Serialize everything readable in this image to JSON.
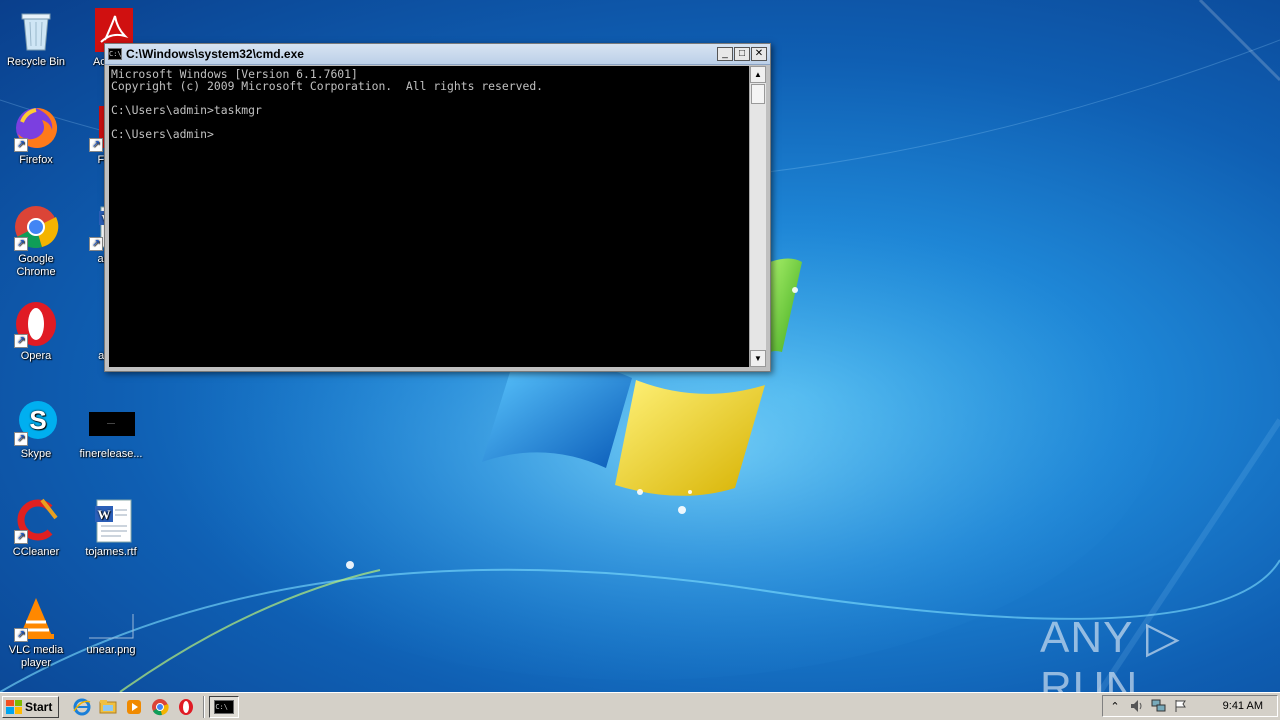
{
  "desktop": {
    "icons": [
      {
        "label": "Recycle Bin",
        "icon": "recycle-bin-icon"
      },
      {
        "label": "Firefox",
        "icon": "firefox-icon"
      },
      {
        "label": "Google Chrome",
        "icon": "chrome-icon"
      },
      {
        "label": "Opera",
        "icon": "opera-icon"
      },
      {
        "label": "Skype",
        "icon": "skype-icon"
      },
      {
        "label": "CCleaner",
        "icon": "ccleaner-icon"
      },
      {
        "label": "VLC media player",
        "icon": "vlc-icon"
      },
      {
        "label": "Ac Rea",
        "icon": "acrobat-icon"
      },
      {
        "label": "FileZi",
        "icon": "filezilla-icon"
      },
      {
        "label": "ansta",
        "icon": "word-doc-icon"
      },
      {
        "label": "away",
        "icon": "file-icon"
      },
      {
        "label": "finerelease...",
        "icon": "black-image-icon"
      },
      {
        "label": "tojames.rtf",
        "icon": "word-doc-icon"
      },
      {
        "label": "unear.png",
        "icon": "image-file-icon"
      }
    ]
  },
  "cmd_window": {
    "title": "C:\\Windows\\system32\\cmd.exe",
    "icon_text": "C:\\",
    "lines": [
      "Microsoft Windows [Version 6.1.7601]",
      "Copyright (c) 2009 Microsoft Corporation.  All rights reserved.",
      "",
      "C:\\Users\\admin>taskmgr",
      "",
      "C:\\Users\\admin>"
    ],
    "buttons": {
      "minimize": "_",
      "maximize": "□",
      "close": "✕"
    }
  },
  "taskbar": {
    "start_label": "Start",
    "quick_launch": [
      "ie-icon",
      "explorer-icon",
      "media-player-icon",
      "chrome-icon",
      "opera-icon"
    ],
    "tasks": [
      "cmd-icon"
    ],
    "tray": {
      "icons": [
        "show-hidden-icon",
        "volume-icon",
        "network-icon",
        "action-center-flag-icon"
      ],
      "clock": "9:41 AM"
    }
  },
  "watermark": "ANY ▷ RUN"
}
